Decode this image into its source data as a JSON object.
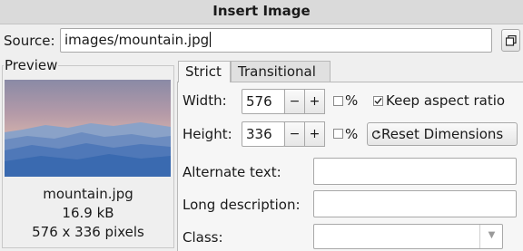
{
  "dialog": {
    "title": "Insert Image"
  },
  "source": {
    "label": "Source:",
    "value": "images/mountain.jpg"
  },
  "preview": {
    "legend": "Preview",
    "file_name": "mountain.jpg",
    "file_size": "16.9 kB",
    "dimensions": "576 x 336 pixels"
  },
  "tabs": [
    {
      "label": "Strict",
      "active": true
    },
    {
      "label": "Transitional",
      "active": false
    }
  ],
  "form": {
    "width_label": "Width:",
    "width_value": "576",
    "height_label": "Height:",
    "height_value": "336",
    "minus_label": "−",
    "plus_label": "+",
    "percent_label": "%",
    "keep_aspect_label": "Keep aspect ratio",
    "keep_aspect_checked": true,
    "width_percent_checked": false,
    "height_percent_checked": false,
    "reset_label": "Reset Dimensions",
    "alt_label": "Alternate text:",
    "alt_value": "",
    "longdesc_label": "Long description:",
    "longdesc_value": "",
    "class_label": "Class:",
    "class_value": ""
  },
  "icons": {
    "browse": "browse-file-icon",
    "reset": "reset-icon",
    "dropdown": "dropdown-arrow-icon",
    "check": "checkmark-icon"
  }
}
